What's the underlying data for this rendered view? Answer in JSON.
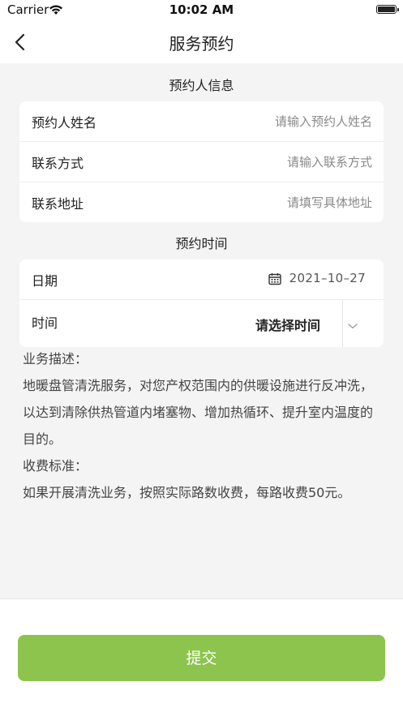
{
  "status_bar": {
    "carrier": "Carrier",
    "time": "10:02 AM"
  },
  "navbar": {
    "title": "服务预约",
    "back_icon": "chevron-left-icon"
  },
  "section_booker": {
    "title": "预约人信息",
    "fields": [
      {
        "label": "预约人姓名",
        "placeholder": "请输入预约人姓名",
        "value": ""
      },
      {
        "label": "联系方式",
        "placeholder": "请输入联系方式",
        "value": ""
      },
      {
        "label": "联系地址",
        "placeholder": "请填写具体地址",
        "value": ""
      }
    ]
  },
  "section_time": {
    "title": "预约时间",
    "date_label": "日期",
    "date_value": "2021–10–27",
    "date_icon": "calendar-icon",
    "time_label": "时间",
    "time_select": "请选择时间",
    "time_chevron_icon": "chevron-down-icon"
  },
  "description": {
    "biz_title": "业务描述：",
    "biz_text": "地暖盘管清洗服务，对您产权范围内的供暖设施进行反冲洗，以达到清除供热管道内堵塞物、增加热循环、提升室内温度的目的。",
    "fee_title": "收费标准：",
    "fee_text": "如果开展清洗业务，按照实际路数收费，每路收费50元。"
  },
  "footer": {
    "submit_label": "提交"
  },
  "colors": {
    "accent": "#8cc44e",
    "background": "#f4f4f4"
  }
}
